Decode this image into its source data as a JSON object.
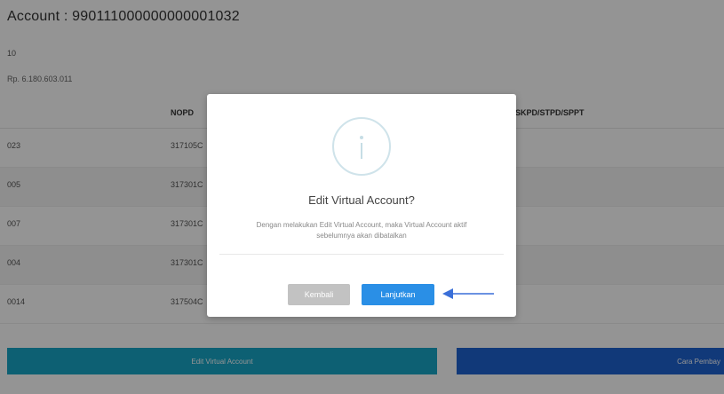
{
  "header": {
    "account_title": "Account : 990111000000000001032",
    "meta_line1": "10",
    "meta_line2": "Rp. 6.180.603.011"
  },
  "table": {
    "columns": [
      "",
      "NOPD",
      "SKPD/STPD/SPPT"
    ],
    "rows": [
      {
        "col1": "023",
        "nopd": "317105C"
      },
      {
        "col1": "005",
        "nopd": "317301C"
      },
      {
        "col1": "007",
        "nopd": "317301C"
      },
      {
        "col1": "004",
        "nopd": "317301C"
      },
      {
        "col1": "0014",
        "nopd": "317504C"
      }
    ]
  },
  "footer_buttons": {
    "edit_va_label": "Edit Virtual Account",
    "cara_label": "Cara Pembay"
  },
  "modal": {
    "icon": "info-icon",
    "title": "Edit Virtual Account?",
    "text_line1": "Dengan melakukan Edit Virtual Account, maka Virtual Account aktif",
    "text_line2": "sebelumnya akan dibatalkan",
    "cancel_label": "Kembali",
    "confirm_label": "Lanjutkan"
  },
  "colors": {
    "edit_button": "#18a5c7",
    "cara_button": "#1e62d0",
    "confirm_button": "#2a8fe6",
    "cancel_button": "#c2c2c2",
    "arrow": "#3a6fd8"
  }
}
